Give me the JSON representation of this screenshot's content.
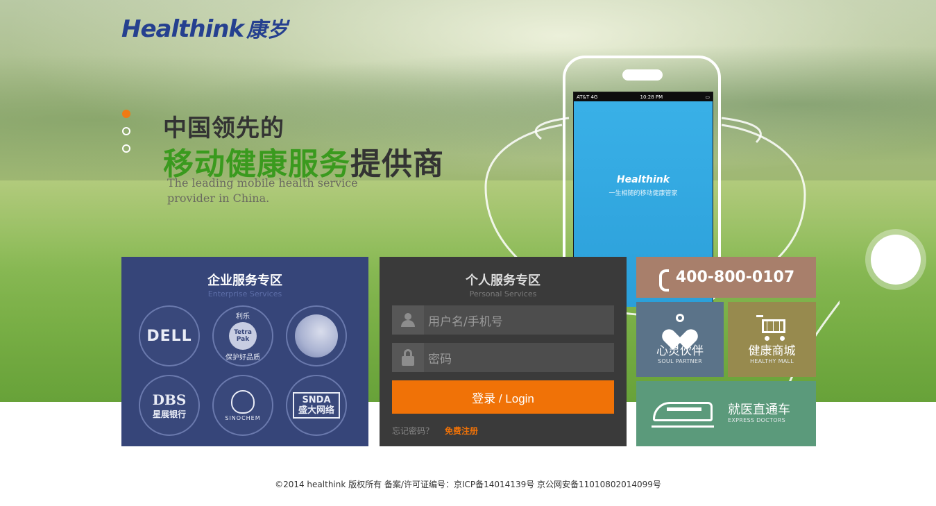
{
  "brand": {
    "logo_en": "Healthink",
    "logo_zh": "康岁"
  },
  "hero": {
    "headline_line1": "中国领先的",
    "headline_green": "移动健康服务",
    "headline_dark": "提供商",
    "tagline": "The leading mobile health service provider in China.",
    "slides": [
      {
        "active": true
      },
      {
        "active": false
      },
      {
        "active": false
      }
    ]
  },
  "phone_screen": {
    "carrier": "AT&T 4G",
    "time": "10:28 PM",
    "app_name": "Healthink",
    "app_tagline": "一生相随的移动健康管家"
  },
  "enterprise": {
    "title": "企业服务专区",
    "subtitle": "Enterprise Services",
    "partners": {
      "dell": "DELL",
      "tetra_top": "利乐",
      "tetra_mark": "Tetra Pak",
      "tetra_bottom": "保护好品质",
      "dbs_en": "DBS",
      "dbs_zh": "星展银行",
      "sinochem": "SINOCHEM",
      "snda_en": "SNDA",
      "snda_zh": "盛大网络"
    }
  },
  "personal": {
    "title": "个人服务专区",
    "subtitle": "Personal Services",
    "username_placeholder": "用户名/手机号",
    "password_placeholder": "密码",
    "login_label": "登录 / Login",
    "forgot_label": "忘记密码？",
    "register_label": "免费注册"
  },
  "tiles": {
    "hotline": "400-800-0107",
    "soul_zh": "心灵伙伴",
    "soul_en": "SOUL PARTNER",
    "mall_zh": "健康商城",
    "mall_en": "HEALTHY MALL",
    "express_zh": "就医直通车",
    "express_en": "EXPRESS DOCTORS"
  },
  "footer": {
    "text": "©2014 healthink  版权所有  备案/许可证编号：京ICP备14014139号  京公网安备11010802014099号"
  },
  "colors": {
    "brand_blue": "#25408f",
    "accent_orange": "#f07207",
    "enterprise_bg": "#364579",
    "personal_bg": "#3a3a3a",
    "hotline_bg": "#a87f6b",
    "soul_bg": "#5b7389",
    "mall_bg": "#978a4e",
    "express_bg": "#5b9a7b"
  },
  "icons": [
    "phone-handset-icon",
    "user-icon",
    "lock-icon",
    "heart-icon",
    "cart-icon",
    "train-icon"
  ]
}
